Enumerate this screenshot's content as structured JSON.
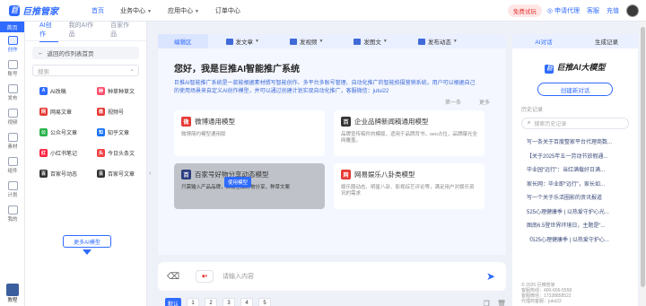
{
  "brand": {
    "logo_char": "巨",
    "name": "巨推管家"
  },
  "topnav": [
    {
      "label": "首页",
      "active": true,
      "dropdown": false
    },
    {
      "label": "业务中心",
      "active": false,
      "dropdown": true
    },
    {
      "label": "应用中心",
      "active": false,
      "dropdown": true
    },
    {
      "label": "订单中心",
      "active": false,
      "dropdown": false
    }
  ],
  "topright": {
    "trial": "免费试玩",
    "apply": "申请代理",
    "customer": "客服",
    "recharge": "充值"
  },
  "rail": {
    "home": "首页",
    "items": [
      {
        "label": "创作",
        "active": true
      },
      {
        "label": "账号",
        "active": false
      },
      {
        "label": "发布",
        "active": false
      },
      {
        "label": "视频",
        "active": false
      },
      {
        "label": "素材",
        "active": false
      },
      {
        "label": "组件",
        "active": false
      },
      {
        "label": "计划",
        "active": false
      },
      {
        "label": "我的",
        "active": false
      }
    ],
    "bottom": "教程"
  },
  "lpanel": {
    "tabs": [
      {
        "label": "AI创作",
        "active": true
      },
      {
        "label": "我的AI作品",
        "active": false
      },
      {
        "label": "百家作品",
        "active": false
      }
    ],
    "back": "返回的作列表首页",
    "search_placeholder": "搜索",
    "items": [
      {
        "label": "AI改稿",
        "color": "#2f6bff",
        "icon": "A"
      },
      {
        "label": "种草种草文",
        "color": "#ff4d6a",
        "icon": "种"
      },
      {
        "label": "网易文章",
        "color": "#e53935",
        "icon": "网"
      },
      {
        "label": "视频号",
        "color": "#e53935",
        "icon": "微"
      },
      {
        "label": "公众号文章",
        "color": "#2bb24c",
        "icon": "公"
      },
      {
        "label": "知乎文章",
        "color": "#1772f6",
        "icon": "知"
      },
      {
        "label": "小红书笔记",
        "color": "#ff2442",
        "icon": "红"
      },
      {
        "label": "今日头条文",
        "color": "#f04142",
        "icon": "头"
      },
      {
        "label": "百家号动态",
        "color": "#333333",
        "icon": "百"
      },
      {
        "label": "百家号文章",
        "color": "#333333",
        "icon": "百"
      }
    ],
    "more": "更多AI模型"
  },
  "center": {
    "toolbar": [
      {
        "label": "编辑区",
        "active": true
      },
      {
        "label": "发文章",
        "active": false
      },
      {
        "label": "发视频",
        "active": false
      },
      {
        "label": "发图文",
        "active": false
      },
      {
        "label": "发布动态",
        "active": false
      }
    ],
    "welcome": "您好，我是巨推AI智能推广系统",
    "desc": "巨推AI智能推广系统是一款能根据素材撰写智能创作、多平台多账号管理、自动化推广的智能拍摄营销系统，用户可以根据自己的使用场景来自定义AI创作模型，并可以通过创建计划实现自动化推广，客服微信：jutui22",
    "prev": "第一条",
    "more": "更多",
    "cards": [
      {
        "title": "微博通用模型",
        "desc": "微博简约模型通用版",
        "icon": "微",
        "color": "#e53935",
        "selected": false
      },
      {
        "title": "企业品牌新闻稿通用模型",
        "desc": "品牌宣传稿件的模版，适用于品牌背书，seo占位，品牌曝光全网覆盖。",
        "icon": "百",
        "color": "#333333",
        "selected": false
      },
      {
        "title": "百家号好物分享动态模型",
        "desc": "只需输入产品品牌，自动生成好物分享，种草文案",
        "icon": "百",
        "color": "#2c3e80",
        "selected": true,
        "use": "使用模型"
      },
      {
        "title": "网易娱乐八卦类模型",
        "desc": "娱乐圈动态、明星八卦、影视综艺评论等，满足用户对娱乐资讯的需求",
        "icon": "网",
        "color": "#e53935",
        "selected": false
      }
    ],
    "input_placeholder": "请输入内容",
    "pages": [
      "默认",
      "1",
      "2",
      "3",
      "4",
      "5"
    ]
  },
  "rpanel": {
    "tabs": [
      {
        "label": "AI对话",
        "active": true
      },
      {
        "label": "生成记录",
        "active": false
      }
    ],
    "logo": "巨推AI大模型",
    "new_chat": "创建新对话",
    "history_label": "历史记录",
    "search_placeholder": "搜索历史记录",
    "history": [
      "写一条关于百度整家平台代理商数...",
      "【关于2025年五一劳动节放假通...",
      "毕业园“远行”：当红满载好日满...",
      "家长网：毕业即“远行”，家长如...",
      "写一个关于乐活圈影的资讯报道",
      "525心理健康季 | 以热爱守护心光...",
      "图南6.5登世界环境日，主题是“...",
      "《525心理健康季 | 以热爱守护心..."
    ],
    "footer": [
      "© 2025 巨推管家",
      "客服热线：400-606-5558",
      "客服微信：17338858522",
      "代理商客服：jutui22"
    ]
  }
}
